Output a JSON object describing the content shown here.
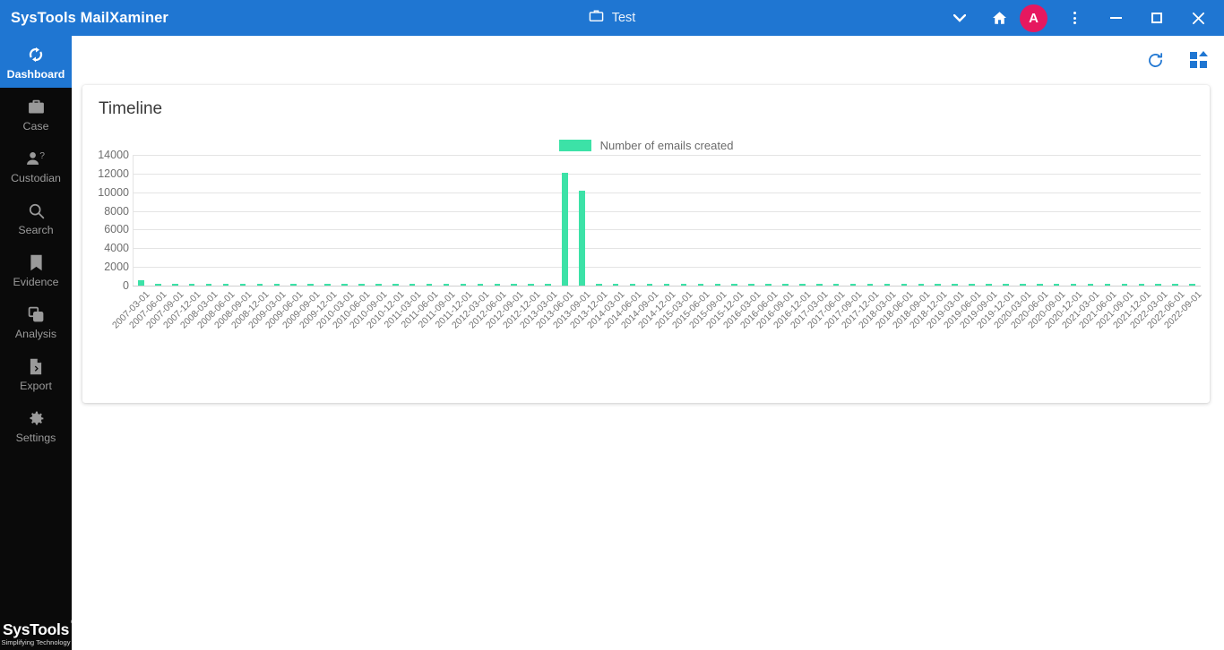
{
  "window": {
    "app_title": "SysTools MailXaminer",
    "case_icon": "briefcase-icon",
    "case_name": "Test",
    "caret_icon": "chevron-down-icon",
    "home_icon": "home-icon",
    "avatar_initial": "A",
    "avatar_color": "#e6185f",
    "overflow_icon": "vertical-dots-icon",
    "minimize_icon": "minimize-icon",
    "maximize_icon": "maximize-icon",
    "close_icon": "close-icon",
    "header_color": "#1f76d2"
  },
  "sidebar": {
    "background": "#0a0a0a",
    "active_color": "#1f76d2",
    "items": [
      {
        "label": "Dashboard",
        "icon": "sync-refresh-icon",
        "active": true
      },
      {
        "label": "Case",
        "icon": "briefcase-icon",
        "active": false
      },
      {
        "label": "Custodian",
        "icon": "person-question-icon",
        "active": false
      },
      {
        "label": "Search",
        "icon": "magnifier-icon",
        "active": false
      },
      {
        "label": "Evidence",
        "icon": "bookmark-icon",
        "active": false
      },
      {
        "label": "Analysis",
        "icon": "layers-icon",
        "active": false
      },
      {
        "label": "Export",
        "icon": "document-export-icon",
        "active": false
      },
      {
        "label": "Settings",
        "icon": "gear-icon",
        "active": false
      }
    ],
    "brand": {
      "name": "SysTools",
      "registered": "®",
      "tagline": "Simplifying Technology"
    }
  },
  "toolbar": {
    "refresh_icon": "refresh-icon",
    "widgets_icon": "grid-widgets-icon",
    "icon_color": "#1f76d2"
  },
  "card": {
    "title": "Timeline"
  },
  "chart_data": {
    "type": "bar",
    "title": "Timeline",
    "xlabel": "",
    "ylabel": "",
    "ylim": [
      0,
      14000
    ],
    "yticks": [
      0,
      2000,
      4000,
      6000,
      8000,
      10000,
      12000,
      14000
    ],
    "grid": true,
    "legend_position": "top-center",
    "bar_color": "#3ce2a7",
    "series": [
      {
        "name": "Number of emails created",
        "values": [
          620,
          230,
          210,
          200,
          215,
          205,
          195,
          210,
          200,
          190,
          205,
          200,
          215,
          200,
          210,
          195,
          205,
          200,
          210,
          195,
          205,
          200,
          210,
          195,
          205,
          12100,
          10200,
          215,
          200,
          210,
          195,
          205,
          200,
          195,
          210,
          200,
          195,
          205,
          200,
          210,
          195,
          200,
          205,
          195,
          200,
          210,
          195,
          200,
          205,
          195,
          200,
          210,
          195,
          200,
          205,
          195,
          200,
          210,
          195,
          200,
          205,
          195,
          200,
          205
        ]
      }
    ],
    "categories": [
      "2007-03-01",
      "2007-06-01",
      "2007-09-01",
      "2007-12-01",
      "2008-03-01",
      "2008-06-01",
      "2008-09-01",
      "2008-12-01",
      "2009-03-01",
      "2009-06-01",
      "2009-09-01",
      "2009-12-01",
      "2010-03-01",
      "2010-06-01",
      "2010-09-01",
      "2010-12-01",
      "2011-03-01",
      "2011-06-01",
      "2011-09-01",
      "2011-12-01",
      "2012-03-01",
      "2012-06-01",
      "2012-09-01",
      "2012-12-01",
      "2013-03-01",
      "2013-06-01",
      "2013-09-01",
      "2013-12-01",
      "2014-03-01",
      "2014-06-01",
      "2014-09-01",
      "2014-12-01",
      "2015-03-01",
      "2015-06-01",
      "2015-09-01",
      "2015-12-01",
      "2016-03-01",
      "2016-06-01",
      "2016-09-01",
      "2016-12-01",
      "2017-03-01",
      "2017-06-01",
      "2017-09-01",
      "2017-12-01",
      "2018-03-01",
      "2018-06-01",
      "2018-09-01",
      "2018-12-01",
      "2019-03-01",
      "2019-06-01",
      "2019-09-01",
      "2019-12-01",
      "2020-03-01",
      "2020-06-01",
      "2020-09-01",
      "2020-12-01",
      "2021-03-01",
      "2021-06-01",
      "2021-09-01",
      "2021-12-01",
      "2022-03-01",
      "2022-06-01",
      "2022-09-01"
    ]
  }
}
